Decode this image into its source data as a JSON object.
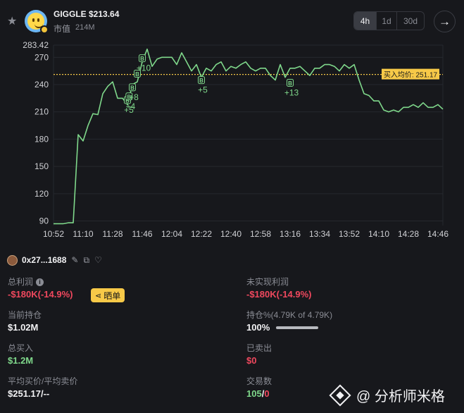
{
  "token": {
    "name": "GIGGLE",
    "price": "$213.64",
    "mcap_label": "市值",
    "mcap_value": "214M"
  },
  "range": {
    "options": [
      "4h",
      "1d",
      "30d"
    ],
    "selected": "4h"
  },
  "icons": {
    "favorite": "star-icon",
    "next": "arrow-right-icon",
    "edit": "pencil-icon",
    "copy": "copy-icon",
    "tag": "tag-icon",
    "info": "info-icon",
    "share": "share-icon"
  },
  "colors": {
    "line": "#7fd88b",
    "avg_line": "#f7c948",
    "loss": "#f0485e",
    "gain": "#7fd88b"
  },
  "chart_data": {
    "type": "line",
    "x": [
      "10:52",
      "10:55",
      "10:58",
      "11:01",
      "11:04",
      "11:07",
      "11:10",
      "11:13",
      "11:16",
      "11:19",
      "11:22",
      "11:25",
      "11:28",
      "11:31",
      "11:34",
      "11:37",
      "11:40",
      "11:43",
      "11:46",
      "11:49",
      "11:52",
      "11:55",
      "11:58",
      "12:01",
      "12:04",
      "12:07",
      "12:10",
      "12:13",
      "12:16",
      "12:19",
      "12:22",
      "12:25",
      "12:28",
      "12:31",
      "12:34",
      "12:37",
      "12:40",
      "12:43",
      "12:46",
      "12:49",
      "12:52",
      "12:55",
      "12:58",
      "13:01",
      "13:04",
      "13:07",
      "13:10",
      "13:13",
      "13:16",
      "13:19",
      "13:22",
      "13:25",
      "13:28",
      "13:31",
      "13:34",
      "13:37",
      "13:40",
      "13:43",
      "13:46",
      "13:49",
      "13:52",
      "13:55",
      "13:58",
      "14:01",
      "14:04",
      "14:07",
      "14:10",
      "14:13",
      "14:16",
      "14:19",
      "14:22",
      "14:25",
      "14:28",
      "14:31",
      "14:34",
      "14:37",
      "14:40",
      "14:43",
      "14:46",
      "14:49"
    ],
    "values": [
      87,
      87,
      87,
      88,
      88,
      185,
      178,
      195,
      208,
      207,
      230,
      238,
      243,
      225,
      225,
      218,
      240,
      243,
      265,
      279,
      260,
      268,
      270,
      270,
      270,
      262,
      275,
      265,
      255,
      262,
      248,
      258,
      255,
      262,
      265,
      255,
      260,
      258,
      262,
      265,
      258,
      255,
      258,
      258,
      250,
      245,
      262,
      248,
      258,
      258,
      260,
      255,
      250,
      258,
      258,
      262,
      262,
      260,
      255,
      262,
      258,
      262,
      245,
      230,
      228,
      222,
      222,
      212,
      210,
      212,
      210,
      215,
      215,
      218,
      215,
      220,
      215,
      215,
      218,
      213
    ],
    "ylim": [
      85,
      283.42
    ],
    "y_ticks": [
      90,
      120,
      150,
      180,
      210,
      240,
      270
    ],
    "y_max_label": "283.42",
    "x_ticks": [
      "10:52",
      "11:10",
      "11:28",
      "11:46",
      "12:04",
      "12:22",
      "12:40",
      "12:58",
      "13:16",
      "13:34",
      "13:52",
      "14:10",
      "14:28",
      "14:46"
    ],
    "avg_buy_price": 251.17,
    "avg_label": "买入均价: 251.17",
    "buy_marks": [
      {
        "x": "11:37",
        "y": 223,
        "label": "+5"
      },
      {
        "x": "11:38",
        "y": 227,
        "label": "+4"
      },
      {
        "x": "11:40",
        "y": 237,
        "label": "+8"
      },
      {
        "x": "11:43",
        "y": 252,
        "label": ""
      },
      {
        "x": "11:46",
        "y": 269,
        "label": "+10"
      },
      {
        "x": "12:22",
        "y": 245,
        "label": "+5"
      },
      {
        "x": "13:16",
        "y": 242,
        "label": "+13"
      }
    ],
    "buy_marker_glyph": "B"
  },
  "wallet": {
    "address": "0x27...1688"
  },
  "stats": {
    "total_pnl_label": "总利润",
    "total_pnl_value": "-$180K(-14.9%)",
    "share_label": "晒单",
    "unrealized_label": "未实现利润",
    "unrealized_value": "-$180K(-14.9%)",
    "holding_label": "当前持仓",
    "holding_value": "$1.02M",
    "holding_pct_label": "持仓%",
    "holding_pct_detail": "(4.79K of 4.79K)",
    "holding_pct_value": "100%",
    "holding_pct_fraction": 1.0,
    "total_buy_label": "总买入",
    "total_buy_value": "$1.2M",
    "sold_label": "已卖出",
    "sold_value": "$0",
    "avg_price_label": "平均买价/平均卖价",
    "avg_price_value": "$251.17/--",
    "trades_label": "交易数",
    "trades_buy": "105",
    "trades_sep": "/",
    "trades_sell": "0"
  },
  "watermark": {
    "text": "@ 分析师米格"
  }
}
